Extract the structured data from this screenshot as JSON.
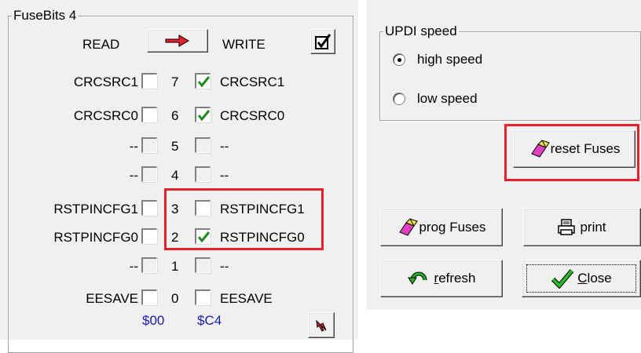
{
  "fusebits": {
    "title": "FuseBits 4",
    "read_label": "READ",
    "write_label": "WRITE",
    "rows": [
      {
        "left": "CRCSRC1",
        "left_checked": false,
        "bit": "7",
        "right_checked": true,
        "right": "CRCSRC1",
        "enabled": true
      },
      {
        "left": "CRCSRC0",
        "left_checked": false,
        "bit": "6",
        "right_checked": true,
        "right": "CRCSRC0",
        "enabled": true
      },
      {
        "left": "--",
        "left_checked": false,
        "bit": "5",
        "right_checked": false,
        "right": "--",
        "enabled": false
      },
      {
        "left": "--",
        "left_checked": false,
        "bit": "4",
        "right_checked": false,
        "right": "--",
        "enabled": false
      },
      {
        "left": "RSTPINCFG1",
        "left_checked": false,
        "bit": "3",
        "right_checked": false,
        "right": "RSTPINCFG1",
        "enabled": true
      },
      {
        "left": "RSTPINCFG0",
        "left_checked": false,
        "bit": "2",
        "right_checked": true,
        "right": "RSTPINCFG0",
        "enabled": true
      },
      {
        "left": "--",
        "left_checked": false,
        "bit": "1",
        "right_checked": false,
        "right": "--",
        "enabled": false
      },
      {
        "left": "EESAVE",
        "left_checked": false,
        "bit": "0",
        "right_checked": false,
        "right": "EESAVE",
        "enabled": true
      }
    ],
    "read_value": "$00",
    "write_value": "$C4"
  },
  "updi": {
    "title": "UPDI speed",
    "high_label": "high speed",
    "low_label": "low speed",
    "selected": "high speed"
  },
  "buttons": {
    "reset": "reset Fuses",
    "prog": "prog Fuses",
    "print": "print",
    "refresh": "refresh",
    "close": "Close"
  },
  "colors": {
    "highlight": "#e8202a",
    "check": "#1f8a1f",
    "value_text": "#1a1aa8",
    "arrow": "#e8202a"
  },
  "icons": {
    "copy_arrow": "red-right-arrow-icon",
    "select_all": "checkmark-box-icon",
    "pointer": "red-cursor-arrow-icon",
    "eraser": "eraser-icon",
    "printer": "printer-icon",
    "refresh": "green-refresh-arrow-icon",
    "close": "green-checkmark-icon"
  }
}
